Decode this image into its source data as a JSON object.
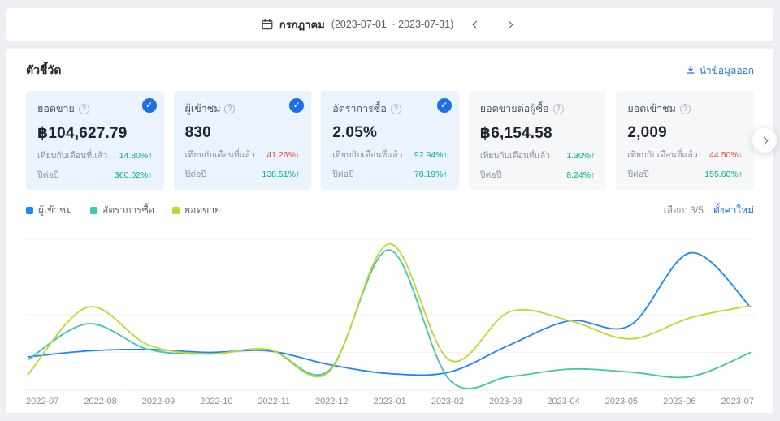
{
  "colors": {
    "accent": "#1f6ee5",
    "up": "#00b578",
    "down": "#f5483b",
    "cardsel": "#ebf3ff"
  },
  "date_bar": {
    "month_label": "กรกฎาคม",
    "range_label": "(2023-07-01 ~ 2023-07-31)"
  },
  "metrics": {
    "section_title": "ตัวชี้วัด",
    "export_label": "นำข้อมูลออก",
    "compare_mom_label": "เทียบกับเดือนที่แล้ว",
    "compare_yoy_label": "ปีต่อปี",
    "cards": [
      {
        "title": "ยอดขาย",
        "value": "฿104,627.79",
        "selected": true,
        "mom": {
          "value": "14.80%↑",
          "trend": "up"
        },
        "yoy": {
          "value": "360.02%↑",
          "trend": "up"
        }
      },
      {
        "title": "ผู้เข้าชม",
        "value": "830",
        "selected": true,
        "mom": {
          "value": "41.26%↓",
          "trend": "down"
        },
        "yoy": {
          "value": "138.51%↑",
          "trend": "up"
        }
      },
      {
        "title": "อัตราการซื้อ",
        "value": "2.05%",
        "selected": true,
        "mom": {
          "value": "92.94%↑",
          "trend": "up"
        },
        "yoy": {
          "value": "78.19%↑",
          "trend": "up"
        }
      },
      {
        "title": "ยอดขายต่อผู้ซื้อ",
        "value": "฿6,154.58",
        "selected": false,
        "mom": {
          "value": "1.30%↑",
          "trend": "up"
        },
        "yoy": {
          "value": "8.24%↑",
          "trend": "up"
        }
      },
      {
        "title": "ยอดเข้าชม",
        "value": "2,009",
        "selected": false,
        "mom": {
          "value": "44.50%↓",
          "trend": "down"
        },
        "yoy": {
          "value": "155.60%↑",
          "trend": "up"
        }
      }
    ],
    "selection": {
      "label": "เลือก: 3/5",
      "reset_label": "ตั้งค่าใหม่"
    }
  },
  "chart_data": {
    "type": "line",
    "categories": [
      "2022-07",
      "2022-08",
      "2022-09",
      "2022-10",
      "2022-11",
      "2022-12",
      "2023-01",
      "2023-02",
      "2023-03",
      "2023-04",
      "2023-05",
      "2023-06",
      "2023-07"
    ],
    "series": [
      {
        "name": "ผู้เข้าชม",
        "color": "#1b84ff",
        "values": [
          22,
          26,
          27,
          25,
          26,
          17,
          11,
          12,
          30,
          46,
          43,
          91,
          55
        ]
      },
      {
        "name": "อัตราการซื้อ",
        "color": "#3fc6ad",
        "values": [
          20,
          44,
          27,
          24,
          27,
          13,
          93,
          7,
          9,
          14,
          12,
          9,
          25
        ]
      },
      {
        "name": "ยอดขาย",
        "color": "#c3d62e",
        "values": [
          10,
          55,
          30,
          24,
          27,
          12,
          97,
          20,
          52,
          46,
          34,
          48,
          56
        ]
      }
    ],
    "ylim": [
      0,
      100
    ],
    "grid": true,
    "legend_position": "top-left",
    "title": ""
  }
}
